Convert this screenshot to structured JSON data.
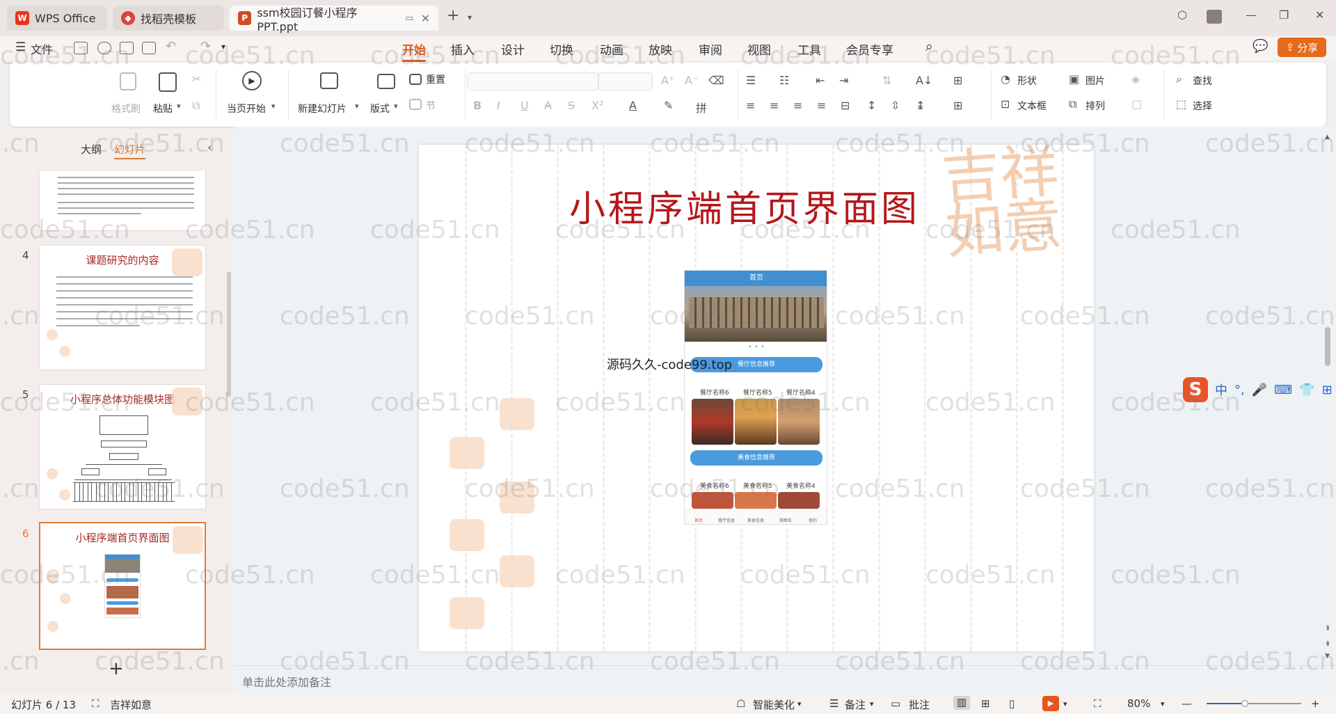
{
  "tabs": [
    {
      "label": "WPS Office",
      "icon": "wps-logo-icon"
    },
    {
      "label": "找稻壳模板",
      "icon": "docer-icon"
    },
    {
      "label": "ssm校园订餐小程序 PPT.ppt",
      "icon": "ppt-file-icon"
    }
  ],
  "file_menu": "文件",
  "menu": [
    "开始",
    "插入",
    "设计",
    "切换",
    "动画",
    "放映",
    "审阅",
    "视图",
    "工具",
    "会员专享"
  ],
  "share_label": "分享",
  "ribbon": {
    "format_painter": "格式刷",
    "paste": "粘贴",
    "play_current": "当页开始",
    "new_slide": "新建幻灯片",
    "layout": "版式",
    "reset": "重置",
    "section": "节",
    "shape": "形状",
    "picture": "图片",
    "find": "查找",
    "textbox": "文本框",
    "arrange": "排列",
    "select": "选择"
  },
  "panel": {
    "outline_tab": "大纲",
    "slides_tab": "幻灯片"
  },
  "thumbnails": [
    {
      "num": "4",
      "title": "课题研究的内容"
    },
    {
      "num": "5",
      "title": "小程序总体功能模块图"
    },
    {
      "num": "6",
      "title": "小程序端首页界面图"
    }
  ],
  "slide": {
    "title": "小程序端首页界面图",
    "seal_text": "吉祥如意",
    "overlay": "源码久久-code99.top",
    "phone": {
      "header": "首页",
      "banner1": "餐厅信息推荐",
      "rest_labels": [
        "餐厅名称6",
        "餐厅名称5",
        "餐厅名称4"
      ],
      "banner2": "美食信息推荐",
      "food_labels": [
        "美食名称6",
        "美食名称5",
        "美食名称4"
      ],
      "nav": [
        "首页",
        "餐厅信息",
        "美食信息",
        "购物车",
        "我的"
      ]
    }
  },
  "notes_placeholder": "单击此处添加备注",
  "status": {
    "slide_pos": "幻灯片 6 / 13",
    "theme": "吉祥如意",
    "beautify": "智能美化",
    "notes": "备注",
    "comment": "批注",
    "zoom": "80%"
  },
  "ime": {
    "mode": "中"
  },
  "watermark": "code51.cn"
}
